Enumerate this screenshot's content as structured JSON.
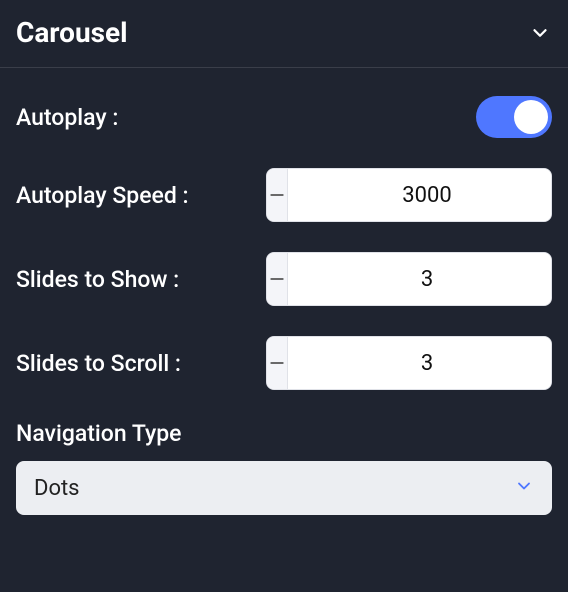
{
  "panel": {
    "title": "Carousel"
  },
  "fields": {
    "autoplay": {
      "label": "Autoplay :",
      "value": true
    },
    "autoplaySpeed": {
      "label": "Autoplay Speed :",
      "value": "3000"
    },
    "slidesToShow": {
      "label": "Slides to Show :",
      "value": "3"
    },
    "slidesToScroll": {
      "label": "Slides to Scroll :",
      "value": "3"
    },
    "navigationType": {
      "label": "Navigation Type",
      "value": "Dots"
    }
  }
}
